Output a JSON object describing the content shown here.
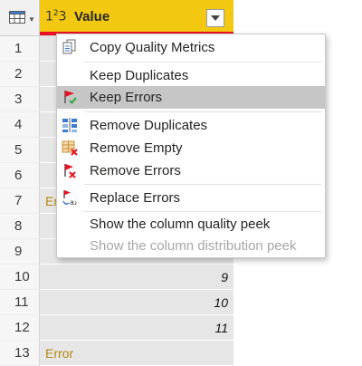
{
  "column": {
    "type_icon_main": "1",
    "type_icon_sup": "2",
    "type_icon_tail": "3",
    "name": "Value"
  },
  "rows": [
    {
      "num": "1",
      "value": "",
      "kind": "empty"
    },
    {
      "num": "2",
      "value": "",
      "kind": "empty"
    },
    {
      "num": "3",
      "value": "",
      "kind": "empty"
    },
    {
      "num": "4",
      "value": "",
      "kind": "empty"
    },
    {
      "num": "5",
      "value": "",
      "kind": "empty"
    },
    {
      "num": "6",
      "value": "",
      "kind": "empty"
    },
    {
      "num": "7",
      "value": "Er",
      "kind": "error"
    },
    {
      "num": "8",
      "value": "",
      "kind": "empty"
    },
    {
      "num": "9",
      "value": "",
      "kind": "empty"
    },
    {
      "num": "10",
      "value": "9",
      "kind": "number"
    },
    {
      "num": "11",
      "value": "10",
      "kind": "number"
    },
    {
      "num": "12",
      "value": "11",
      "kind": "number"
    },
    {
      "num": "13",
      "value": "Error",
      "kind": "error"
    }
  ],
  "menu": {
    "items": [
      {
        "label": "Copy Quality Metrics",
        "icon": "copy-icon"
      },
      {
        "label": "Keep Duplicates",
        "icon": ""
      },
      {
        "label": "Keep Errors",
        "icon": "keep-errors-flag-icon"
      },
      {
        "label": "Remove Duplicates",
        "icon": "remove-duplicates-icon"
      },
      {
        "label": "Remove Empty",
        "icon": "remove-empty-icon"
      },
      {
        "label": "Remove Errors",
        "icon": "remove-errors-icon"
      },
      {
        "label": "Replace Errors",
        "icon": "replace-errors-icon"
      },
      {
        "label": "Show the column quality peek",
        "icon": ""
      },
      {
        "label": "Show the column distribution peek",
        "icon": ""
      }
    ]
  },
  "colors": {
    "header": "#f2c811",
    "highlight": "#c6c6c6",
    "error_text": "#b5870d",
    "quality_error": "#e81123"
  }
}
